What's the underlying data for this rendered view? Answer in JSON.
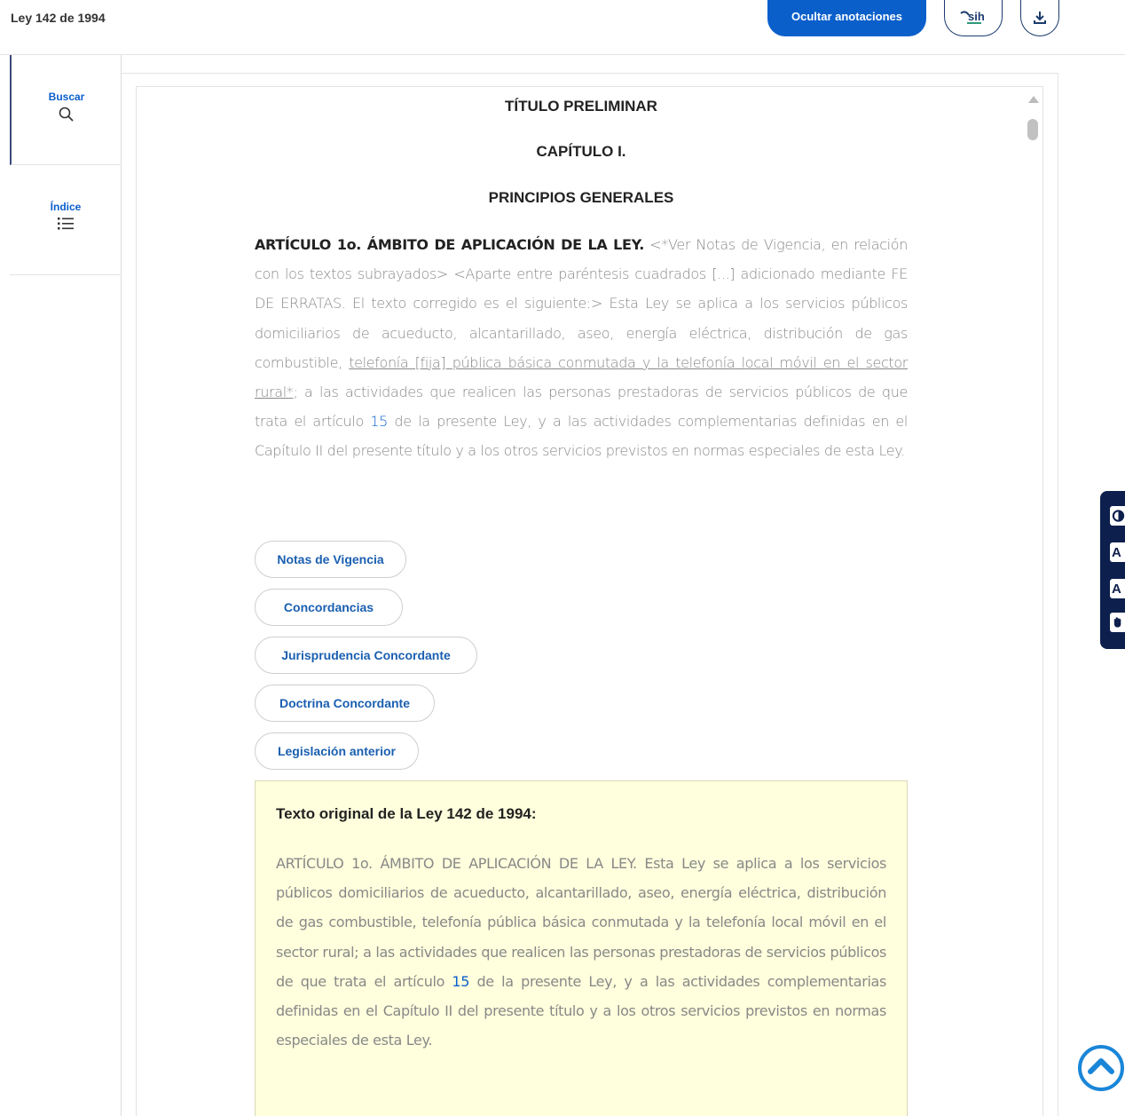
{
  "header": {
    "doc_title": "Ley 142 de 1994",
    "hide_annotations_label": "Ocultar anotaciones",
    "sih_label": "sih"
  },
  "sidebar": {
    "items": [
      {
        "label": "Buscar",
        "icon": "search-icon"
      },
      {
        "label": "Índice",
        "icon": "list-icon"
      }
    ]
  },
  "content": {
    "heading_1": "TÍTULO PRELIMINAR",
    "heading_2": "CAPÍTULO I.",
    "heading_3": "PRINCIPIOS GENERALES",
    "article": {
      "title": "ARTÍCULO 1o. ÁMBITO DE APLICACIÓN DE LA LEY.",
      "text_1": " <*Ver Notas de Vigencia, en relación con los textos subrayados> <Aparte entre paréntesis cuadrados [...] adicionado mediante FE DE ERRATAS. El texto corregido es el siguiente:> Esta Ley se aplica a los servicios públicos domiciliarios de acueducto, alcantarillado, aseo, energía eléctrica, distribución de gas combustible, ",
      "underlined": "telefonía [fija] pública básica conmutada y la telefonía local móvil en el sector rural*",
      "text_2": "; a las actividades que realicen las personas prestadoras de servicios públicos de que trata el artículo ",
      "link": "15",
      "text_3": " de la presente Ley, y a las actividades complementarias definidas en el Capítulo II del presente título y a los otros servicios previstos en normas especiales de esta Ley."
    },
    "pills": [
      "Notas de Vigencia",
      "Concordancias",
      "Jurisprudencia Concordante",
      "Doctrina Concordante",
      "Legislación anterior"
    ],
    "original": {
      "title": "Texto original de la Ley 142 de 1994:",
      "text_1": "ARTÍCULO 1o. ÁMBITO DE APLICACIÓN DE LA LEY. Esta Ley se aplica a los servicios públicos domiciliarios de acueducto, alcantarillado, aseo, energía eléctrica, distribución de gas combustible, telefonía pública básica conmutada y la telefonía local móvil en el sector rural; a las actividades que realicen las personas prestadoras de servicios públicos de que trata el artículo ",
      "link": "15",
      "text_2": " de la presente Ley, y a las actividades complementarias definidas en el Capítulo II del presente título y a los otros servicios previstos en normas especiales de esta Ley."
    }
  },
  "accessibility": {
    "buttons": [
      "contrast-icon",
      "A",
      "A",
      "sign-language-icon"
    ],
    "a_labels": [
      "A",
      "A"
    ]
  },
  "colors": {
    "accent": "#0b5fcb",
    "note_box_bg": "#ffffdd",
    "widget_bg": "#0d1f4d"
  }
}
